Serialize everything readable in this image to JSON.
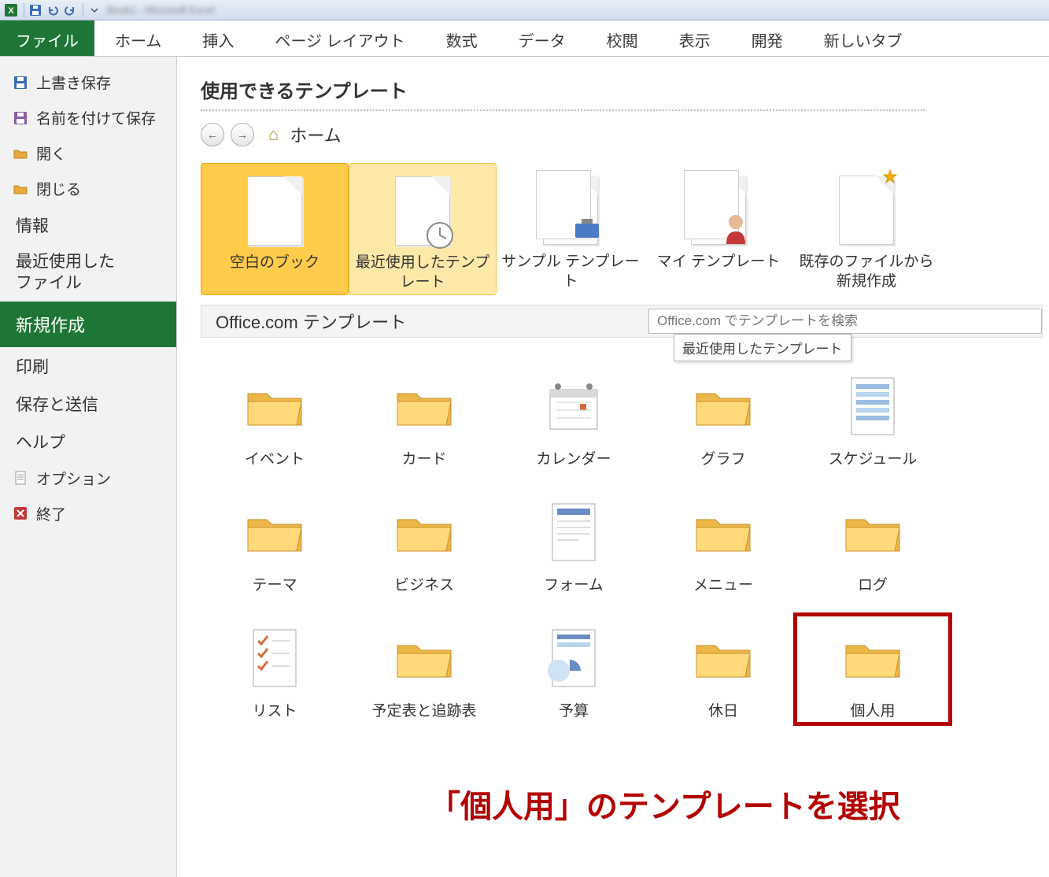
{
  "ribbon": {
    "file": "ファイル",
    "tabs": [
      "ホーム",
      "挿入",
      "ページ レイアウト",
      "数式",
      "データ",
      "校閲",
      "表示",
      "開発",
      "新しいタブ"
    ]
  },
  "leftnav": {
    "save": "上書き保存",
    "saveas": "名前を付けて保存",
    "open": "開く",
    "close": "閉じる",
    "info": "情報",
    "recent": "最近使用した\nファイル",
    "new": "新規作成",
    "print": "印刷",
    "saveSend": "保存と送信",
    "help": "ヘルプ",
    "options": "オプション",
    "exit": "終了"
  },
  "content": {
    "title": "使用できるテンプレート",
    "home": "ホーム",
    "topTiles": [
      {
        "label": "空白のブック",
        "icon": "blank"
      },
      {
        "label": "最近使用したテンプレート",
        "icon": "recent"
      },
      {
        "label": "サンプル テンプレート",
        "icon": "sample"
      },
      {
        "label": "マイ テンプレート",
        "icon": "my"
      },
      {
        "label": "既存のファイルから新規作成",
        "icon": "fromfile"
      }
    ],
    "officeLabel": "Office.com テンプレート",
    "searchPlaceholder": "Office.com でテンプレートを検索",
    "tooltip": "最近使用したテンプレート",
    "categories": [
      {
        "label": "イベント",
        "icon": "folder"
      },
      {
        "label": "カード",
        "icon": "folder"
      },
      {
        "label": "カレンダー",
        "icon": "calendar"
      },
      {
        "label": "グラフ",
        "icon": "folder"
      },
      {
        "label": "スケジュール",
        "icon": "schedule"
      },
      {
        "label": "テーマ",
        "icon": "folder"
      },
      {
        "label": "ビジネス",
        "icon": "folder"
      },
      {
        "label": "フォーム",
        "icon": "form"
      },
      {
        "label": "メニュー",
        "icon": "folder"
      },
      {
        "label": "ログ",
        "icon": "folder"
      },
      {
        "label": "リスト",
        "icon": "list"
      },
      {
        "label": "予定表と追跡表",
        "icon": "folder"
      },
      {
        "label": "予算",
        "icon": "budget"
      },
      {
        "label": "休日",
        "icon": "folder"
      },
      {
        "label": "個人用",
        "icon": "folder",
        "highlight": true
      }
    ]
  },
  "annotation": "「個人用」のテンプレートを選択"
}
